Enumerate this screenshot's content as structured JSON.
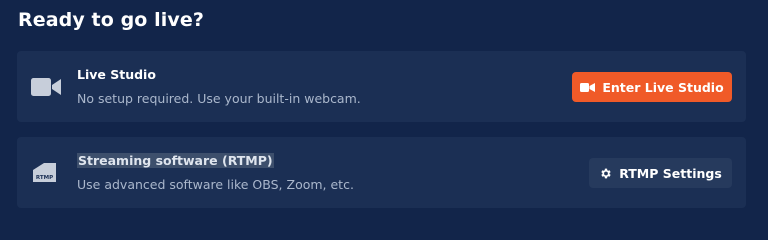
{
  "page": {
    "title": "Ready to go live?"
  },
  "live_studio": {
    "title": "Live Studio",
    "description": "No setup required. Use your built-in webcam.",
    "button_label": "Enter Live Studio",
    "icon": "video-camera-icon"
  },
  "rtmp": {
    "title": "Streaming software (RTMP)",
    "description": "Use advanced software like OBS, Zoom, etc.",
    "button_label": "RTMP Settings",
    "icon": "rtmp-device-icon",
    "icon_text": "RTMP",
    "button_icon": "gear-icon"
  },
  "colors": {
    "background": "#12254a",
    "card": "#1b2f54",
    "accent": "#f05a28",
    "secondary_button": "#263a5d",
    "muted_text": "#aab7cc"
  }
}
